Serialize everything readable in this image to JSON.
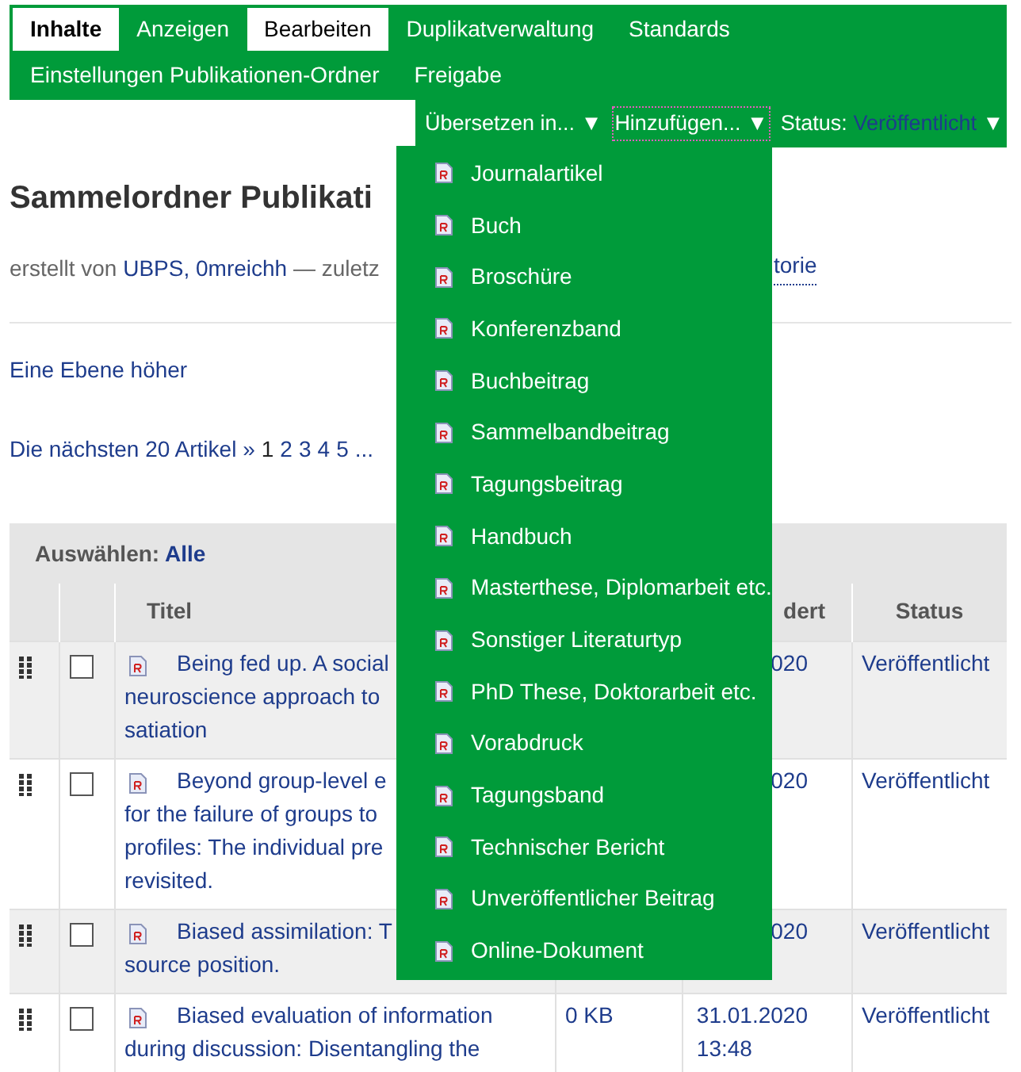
{
  "tab_rows": [
    [
      {
        "label": "Inhalte",
        "selected": true,
        "highlighted": true
      },
      {
        "label": "Anzeigen",
        "selected": false,
        "highlighted": false
      },
      {
        "label": "Bearbeiten",
        "selected": false,
        "highlighted": true
      },
      {
        "label": "Duplikatverwaltung",
        "selected": false,
        "highlighted": false
      },
      {
        "label": "Standards",
        "selected": false,
        "highlighted": false
      }
    ],
    [
      {
        "label": "Einstellungen Publikationen-Ordner",
        "selected": false,
        "highlighted": false
      },
      {
        "label": "Freigabe",
        "selected": false,
        "highlighted": false
      }
    ]
  ],
  "actions": {
    "translate": {
      "label": "Übersetzen in...",
      "caret": "▼",
      "expanded": false
    },
    "add": {
      "label": "Hinzufügen...",
      "caret": "▼",
      "expanded": true
    },
    "status": {
      "label": "Status:",
      "value": "Veröffentlicht",
      "caret": "▼"
    }
  },
  "add_menu": [
    "Journalartikel",
    "Buch",
    "Broschüre",
    "Konferenzband",
    "Buchbeitrag",
    "Sammelbandbeitrag",
    "Tagungsbeitrag",
    "Handbuch",
    "Masterthese, Diplomarbeit etc.",
    "Sonstiger Literaturtyp",
    "PhD These, Doktorarbeit etc.",
    "Vorabdruck",
    "Tagungsband",
    "Technischer Bericht",
    "Unveröffentlicher Beitrag",
    "Online-Dokument"
  ],
  "title": "Sammelordner Publikati",
  "byline": {
    "prefix": "erstellt von",
    "authors": "UBPS, 0mreichh",
    "middle": "— zuletz",
    "history": "torie"
  },
  "up_link": "Eine Ebene höher",
  "pagination": {
    "next": "Die nächsten 20 Artikel »",
    "pages": [
      {
        "label": "1",
        "selected": true
      },
      {
        "label": "2",
        "selected": false
      },
      {
        "label": "3",
        "selected": false
      },
      {
        "label": "4",
        "selected": false
      },
      {
        "label": "5",
        "selected": false
      }
    ],
    "ellipsis": "..."
  },
  "table": {
    "select_label": "Auswählen:",
    "select_all": "Alle",
    "columns": {
      "title": "Titel",
      "modified": "dert",
      "status": "Status"
    },
    "rows": [
      {
        "title": "Being fed up. A social\nneuroscience approach to\nsatiation",
        "size": "",
        "date": "020",
        "time": "",
        "status": "Veröffentlicht",
        "checked": false
      },
      {
        "title": "Beyond group-level e\nfor the failure of groups to\nprofiles: The individual pre\nrevisited.",
        "size": "",
        "date": "020",
        "time": "",
        "status": "Veröffentlicht",
        "checked": false
      },
      {
        "title": "Biased assimilation: T\nsource position.",
        "size": "",
        "date": "020",
        "time": "",
        "status": "Veröffentlicht",
        "checked": false
      },
      {
        "title": "Biased evaluation of information\nduring discussion: Disentangling the",
        "size": "0 KB",
        "date": "31.01.2020",
        "time": "13:48",
        "status": "Veröffentlicht",
        "checked": false
      }
    ]
  }
}
